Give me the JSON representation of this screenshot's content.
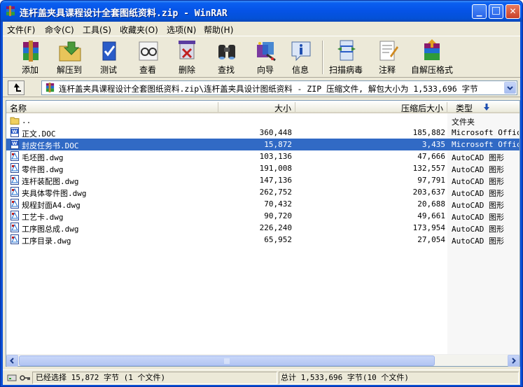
{
  "window": {
    "title": "连杆盖夹具课程设计全套图纸资料.zip - WinRAR",
    "minimize_glyph": "▁",
    "maximize_glyph": "□",
    "close_glyph": "✕",
    "titlebar_color": "#0553e6"
  },
  "menu": [
    {
      "label": "文件(F)",
      "key": "file"
    },
    {
      "label": "命令(C)",
      "key": "commands"
    },
    {
      "label": "工具(S)",
      "key": "tools"
    },
    {
      "label": "收藏夹(O)",
      "key": "favorites"
    },
    {
      "label": "选项(N)",
      "key": "options"
    },
    {
      "label": "帮助(H)",
      "key": "help"
    }
  ],
  "toolbar": {
    "add": "添加",
    "extract_to": "解压到",
    "test": "测试",
    "view": "查看",
    "delete": "删除",
    "find": "查找",
    "wizard": "向导",
    "info": "信息",
    "scan_virus": "扫描病毒",
    "comment": "注释",
    "sfx": "自解压格式"
  },
  "address": {
    "text": "连杆盖夹具课程设计全套图纸资料.zip\\连杆盖夹具设计图纸资料 - ZIP 压缩文件, 解包大小为 1,533,696 字节"
  },
  "columns": {
    "name": "名称",
    "size": "大小",
    "packed": "压缩后大小",
    "type": "类型"
  },
  "files": [
    {
      "name": "..",
      "size": "",
      "packed": "",
      "type": "文件夹",
      "icon": "folder-icon"
    },
    {
      "name": "正文.DOC",
      "size": "360,448",
      "packed": "185,882",
      "type": "Microsoft Offic...",
      "icon": "word-doc-icon"
    },
    {
      "name": "封皮任务书.DOC",
      "size": "15,872",
      "packed": "3,435",
      "type": "Microsoft Offic...",
      "icon": "word-doc-icon"
    },
    {
      "name": "毛坯图.dwg",
      "size": "103,136",
      "packed": "47,666",
      "type": "AutoCAD 图形",
      "icon": "dwg-file-icon"
    },
    {
      "name": "零件图.dwg",
      "size": "191,008",
      "packed": "132,557",
      "type": "AutoCAD 图形",
      "icon": "dwg-file-icon"
    },
    {
      "name": "连杆装配图.dwg",
      "size": "147,136",
      "packed": "97,791",
      "type": "AutoCAD 图形",
      "icon": "dwg-file-icon"
    },
    {
      "name": "夹具体零件图.dwg",
      "size": "262,752",
      "packed": "203,637",
      "type": "AutoCAD 图形",
      "icon": "dwg-file-icon"
    },
    {
      "name": "规程封面A4.dwg",
      "size": "70,432",
      "packed": "20,688",
      "type": "AutoCAD 图形",
      "icon": "dwg-file-icon"
    },
    {
      "name": "工艺卡.dwg",
      "size": "90,720",
      "packed": "49,661",
      "type": "AutoCAD 图形",
      "icon": "dwg-file-icon"
    },
    {
      "name": "工序图总成.dwg",
      "size": "226,240",
      "packed": "173,954",
      "type": "AutoCAD 图形",
      "icon": "dwg-file-icon"
    },
    {
      "name": "工序目录.dwg",
      "size": "65,952",
      "packed": "27,054",
      "type": "AutoCAD 图形",
      "icon": "dwg-file-icon"
    }
  ],
  "selected_row": "封皮任务书.DOC",
  "status": {
    "selection": "已经选择 15,872 字节 (1 个文件)",
    "total": "总计 1,533,696 字节(10 个文件)"
  }
}
